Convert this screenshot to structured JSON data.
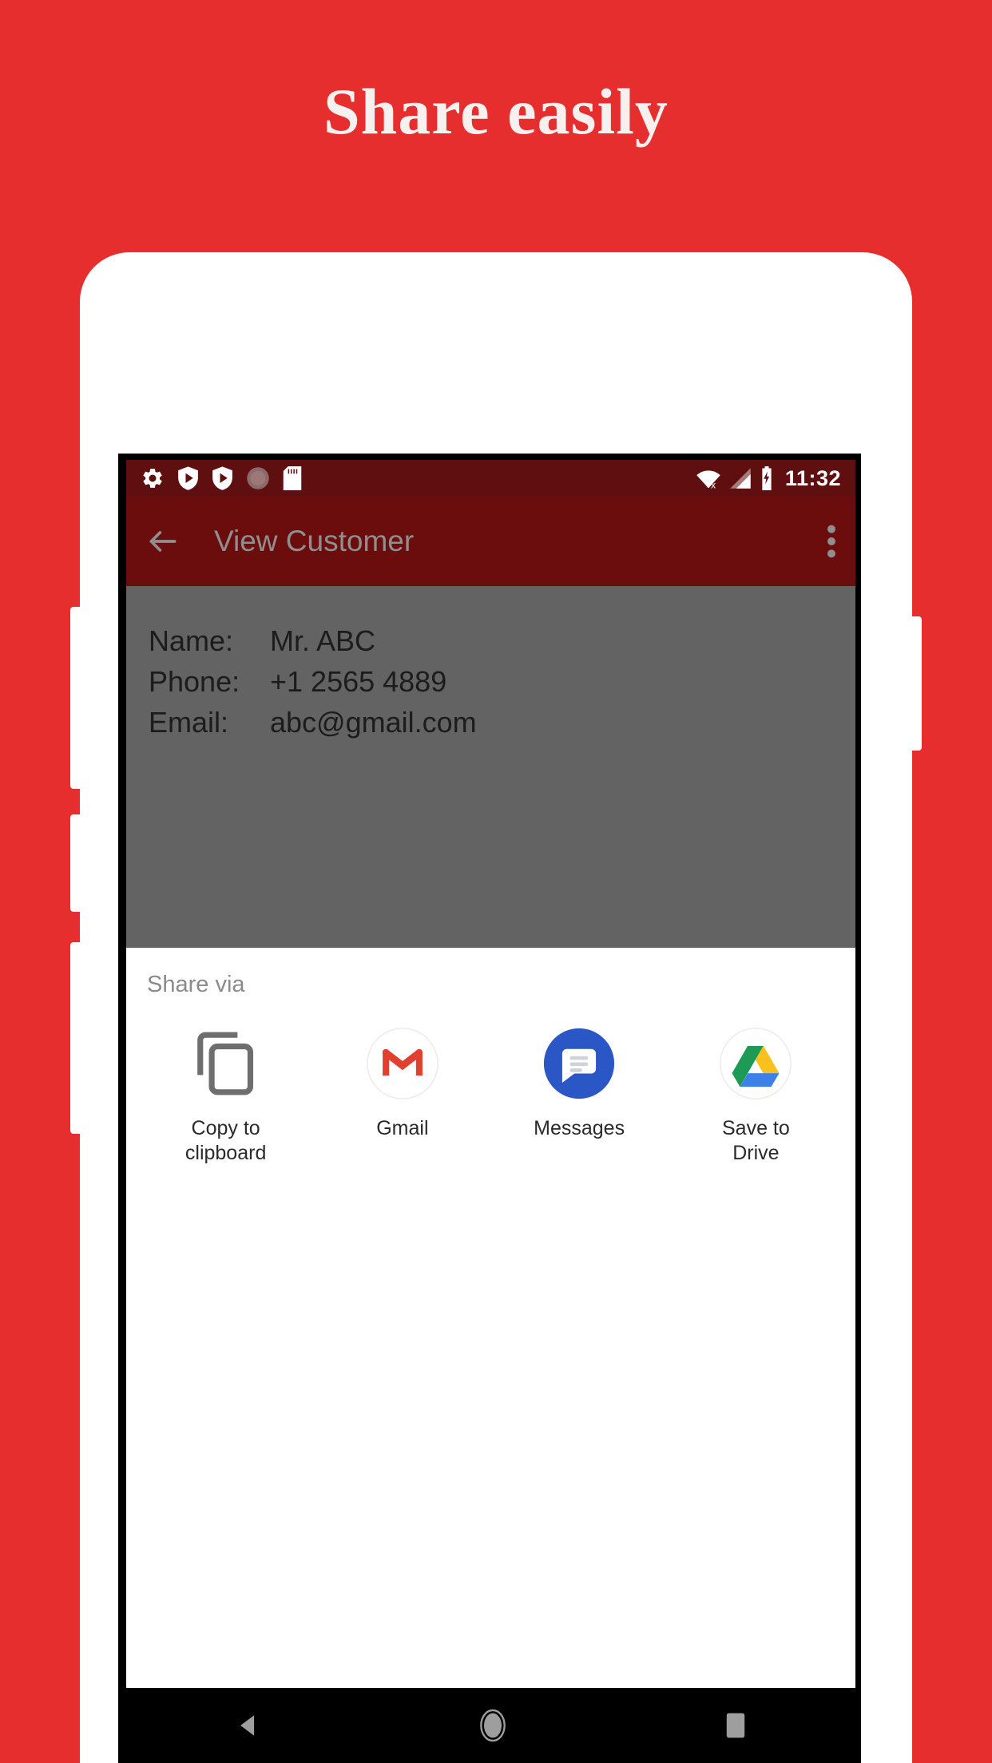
{
  "headline": "Share easily",
  "theme": {
    "background_red": "#e62e2e",
    "appbar_dark_red": "#6b0d0d",
    "statusbar_red": "#5f0f0f",
    "scrim_gray": "#636363",
    "headline_color": "#f6f1ef"
  },
  "status_bar": {
    "time": "11:32",
    "left_icons": [
      "gear-icon",
      "play-shield-icon",
      "play-shield-icon",
      "circle-sync-icon",
      "sd-card-icon"
    ],
    "right_icons": [
      "wifi-off-icon",
      "signal-icon",
      "battery-charging-icon"
    ]
  },
  "app_bar": {
    "title": "View Customer",
    "back_icon": "back-arrow-icon",
    "overflow_icon": "overflow-menu-icon"
  },
  "customer": {
    "rows": [
      {
        "label": "Name:",
        "value": "Mr. ABC"
      },
      {
        "label": "Phone:",
        "value": "+1 2565 4889"
      },
      {
        "label": "Email:",
        "value": "abc@gmail.com"
      }
    ]
  },
  "share_sheet": {
    "title": "Share via",
    "targets": [
      {
        "label": "Copy to clipboard",
        "icon": "copy-to-clipboard-icon"
      },
      {
        "label": "Gmail",
        "icon": "gmail-icon"
      },
      {
        "label": "Messages",
        "icon": "messages-icon"
      },
      {
        "label": "Save to Drive",
        "icon": "google-drive-icon"
      }
    ]
  },
  "nav_bar": {
    "buttons": [
      "back-nav-button",
      "home-nav-button",
      "recents-nav-button"
    ]
  }
}
